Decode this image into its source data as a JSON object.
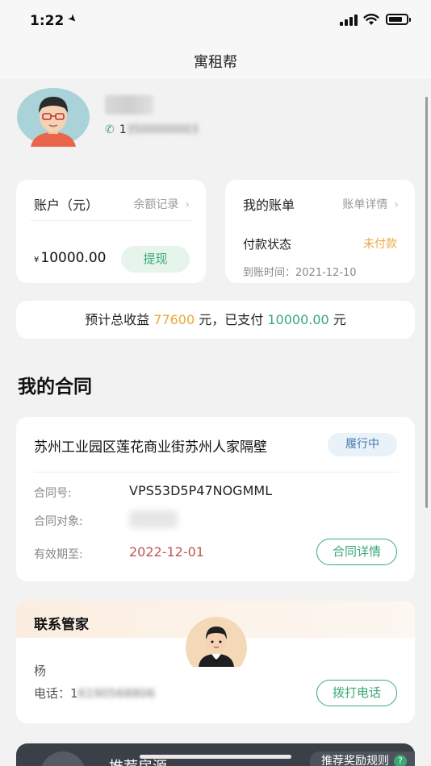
{
  "status_bar": {
    "time": "1:22"
  },
  "nav": {
    "title": "寓租帮"
  },
  "profile": {
    "name": "杨丽",
    "phone": "1",
    "phone_blurred": "3500000003"
  },
  "account": {
    "title": "账户（元）",
    "link": "余额记录",
    "currency": "¥",
    "amount": "10000.00",
    "withdraw": "提现"
  },
  "bill": {
    "title": "我的账单",
    "link": "账单详情",
    "pay_status_label": "付款状态",
    "pay_status_value": "未付款",
    "arrive_time": "到账时间：2021-12-10"
  },
  "earnings": {
    "prefix": "预计总收益",
    "total": "77600",
    "mid": "元，已支付",
    "paid": "10000.00",
    "suffix": "元"
  },
  "contracts": {
    "section_title": "我的合同",
    "title": "苏州工业园区莲花商业街苏州人家隔壁",
    "status": "履行中",
    "no_label": "合同号:",
    "no_value": "VPS53D5P47NOGMML",
    "party_label": "合同对象:",
    "expiry_label": "有效期至:",
    "expiry_value": "2022-12-01",
    "detail_button": "合同详情"
  },
  "manager": {
    "title": "联系管家",
    "name": "杨",
    "phone_label": "电话：",
    "phone_visible": "1",
    "phone_blurred": "6190568806",
    "call_button": "拨打电话"
  },
  "recommend": {
    "title": "推荐房源",
    "rule": "推荐奖励规则",
    "help": "?"
  },
  "colors": {
    "accent_green": "#3aa876",
    "accent_orange": "#e8a93a",
    "expiry_red": "#c0564f"
  }
}
